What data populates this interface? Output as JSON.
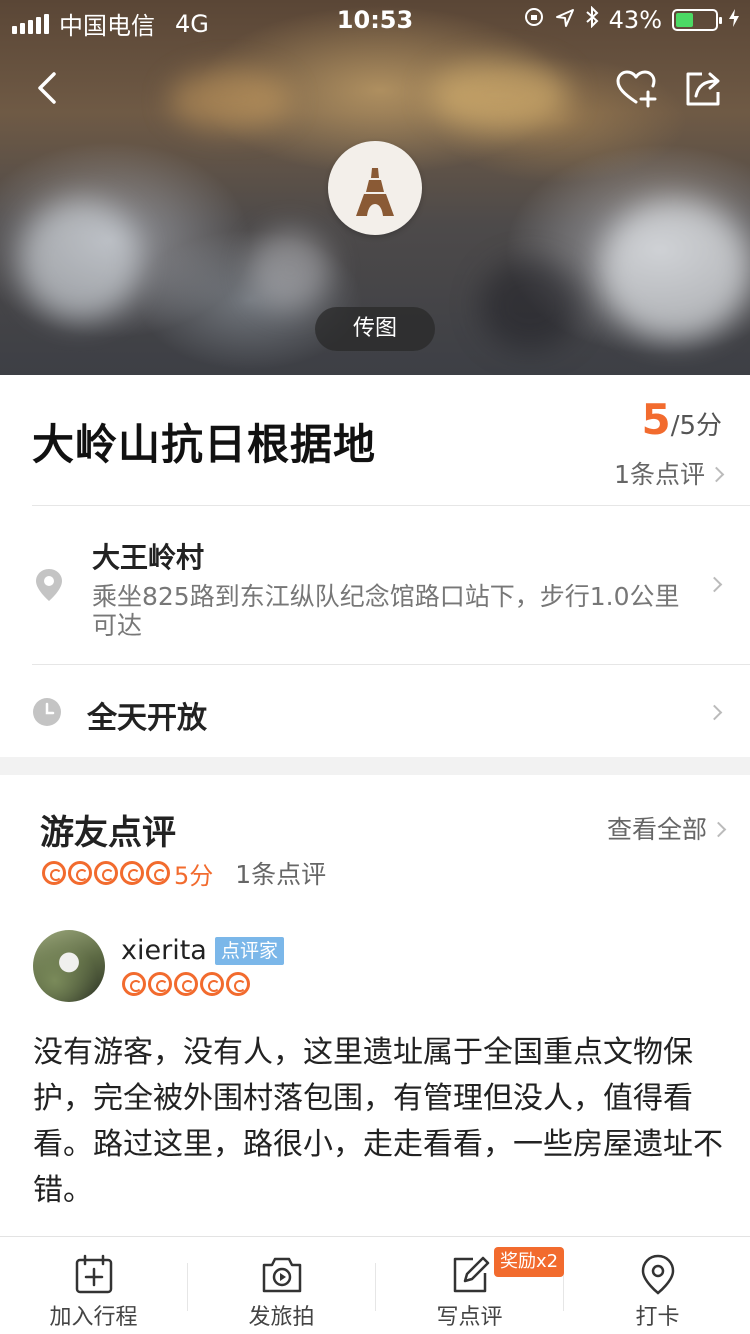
{
  "status_bar": {
    "carrier": "中国电信",
    "network": "4G",
    "time": "10:53",
    "battery": "43%",
    "battery_level": 0.43
  },
  "hero": {
    "upload_label": "传图"
  },
  "poi": {
    "title": "大岭山抗日根据地",
    "score": "5",
    "score_suffix": "/5分",
    "review_count_link": "1条点评"
  },
  "address": {
    "name": "大王岭村",
    "directions": "乘坐825路到东江纵队纪念馆路口站下，步行1.0公里可达"
  },
  "hours": {
    "text": "全天开放"
  },
  "reviews": {
    "section_title": "游友点评",
    "view_all": "查看全部",
    "summary_rating": 5,
    "summary_score": "5分",
    "summary_count": "1条点评",
    "items": [
      {
        "user": "xierita",
        "badge": "点评家",
        "rating": 5,
        "text": "没有游客，没有人，这里遗址属于全国重点文物保护，完全被外围村落包围，有管理但没人，值得看看。路过这里，路很小，走走看看，一些房屋遗址不错。"
      }
    ]
  },
  "bottom_bar": {
    "tabs": [
      {
        "label": "加入行程",
        "icon": "calendar-add-icon"
      },
      {
        "label": "发旅拍",
        "icon": "camera-icon"
      },
      {
        "label": "写点评",
        "icon": "edit-icon"
      },
      {
        "label": "打卡",
        "icon": "location-pin-icon"
      }
    ],
    "reward_badge": "奖励x2"
  },
  "colors": {
    "accent": "#f26b2e",
    "badge_blue": "#7bb7e9"
  }
}
